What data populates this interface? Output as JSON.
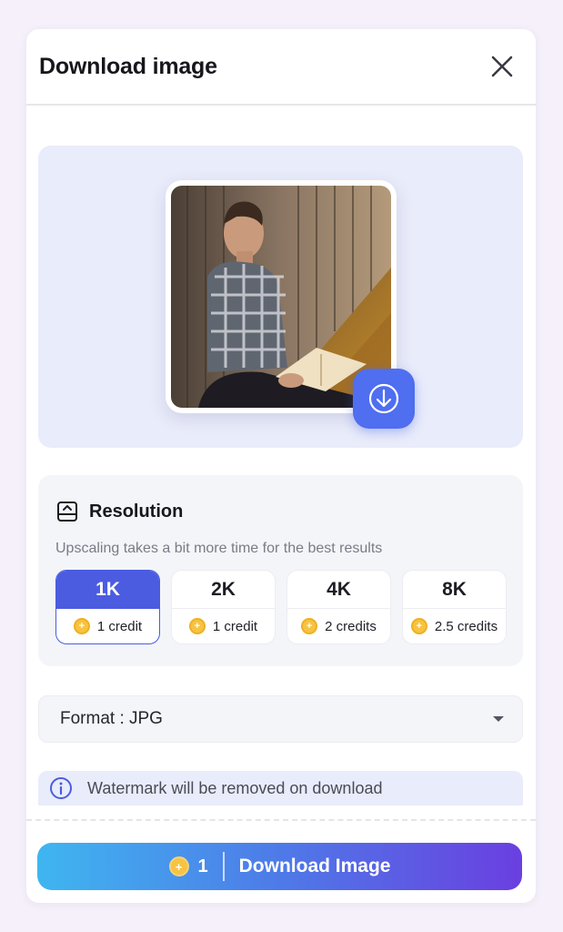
{
  "modal": {
    "title": "Download image",
    "close_icon": "close-icon"
  },
  "preview": {
    "download_icon": "download-circle-icon"
  },
  "resolution": {
    "icon": "resolution-icon",
    "title": "Resolution",
    "subtitle": "Upscaling takes a bit more time for the best results",
    "selected": "1K",
    "options": [
      {
        "label": "1K",
        "credits": "1 credit"
      },
      {
        "label": "2K",
        "credits": "1 credit"
      },
      {
        "label": "4K",
        "credits": "2 credits"
      },
      {
        "label": "8K",
        "credits": "2.5 credits"
      }
    ]
  },
  "format": {
    "label": "Format : JPG",
    "caret_icon": "caret-down-icon"
  },
  "notice": {
    "icon": "info-icon",
    "text": "Watermark will be removed on download"
  },
  "cta": {
    "count": "1",
    "label": "Download Image"
  },
  "colors": {
    "accent": "#4b5ce0",
    "preview_bg": "#e9ecfa",
    "coin": "#f6c342",
    "gradient_start": "#3fb6f0",
    "gradient_end": "#6a3fe0"
  }
}
